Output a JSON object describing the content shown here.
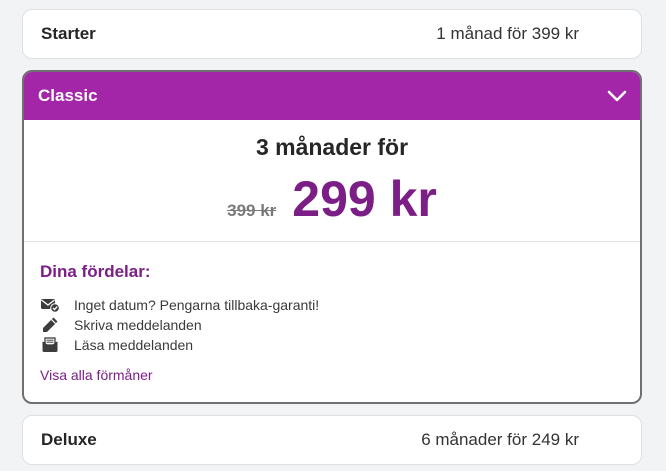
{
  "plans": {
    "starter": {
      "name": "Starter",
      "price_text": "1 månad för 399 kr"
    },
    "classic": {
      "name": "Classic",
      "period": "3 månader för",
      "old_price": "399 kr",
      "new_price": "299 kr",
      "benefits_title": "Dina fördelar:",
      "benefits": [
        {
          "icon": "envelope-check-icon",
          "label": "Inget datum? Pengarna tillbaka-garanti!"
        },
        {
          "icon": "pencil-icon",
          "label": "Skriva meddelanden"
        },
        {
          "icon": "inbox-open-icon",
          "label": "Läsa meddelanden"
        }
      ],
      "see_all_link": "Visa alla förmåner"
    },
    "deluxe": {
      "name": "Deluxe",
      "price_text": "6 månader för 249 kr"
    }
  },
  "colors": {
    "accent": "#a326a8",
    "accent_text": "#7b1f87",
    "background": "#f1f3f5"
  }
}
